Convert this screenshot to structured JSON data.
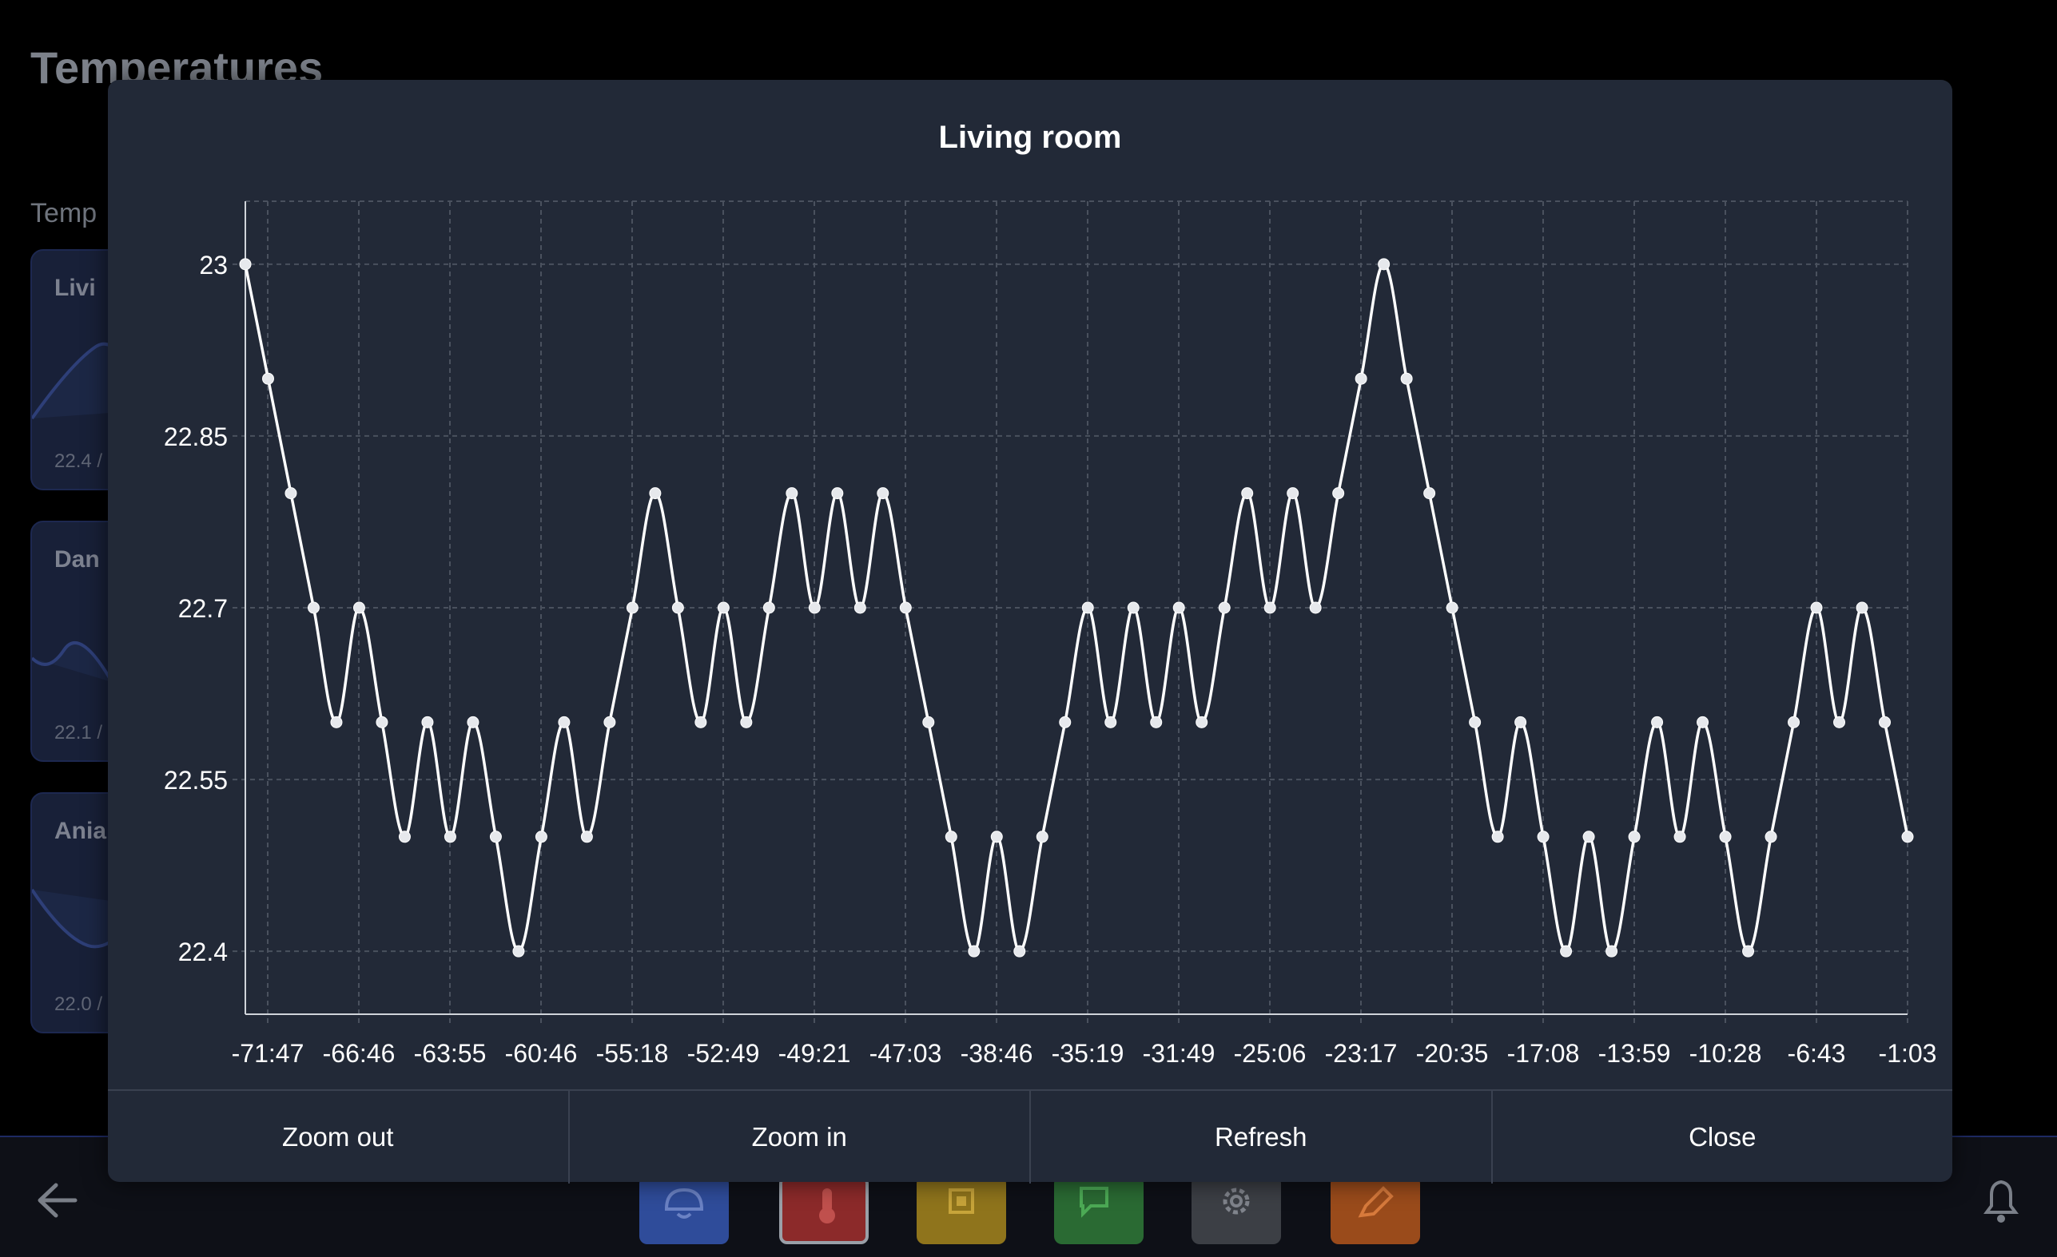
{
  "page": {
    "title": "Temperatures",
    "section_label": "Temp"
  },
  "cards": [
    {
      "title": "Livi",
      "value": "22.4 /"
    },
    {
      "title": "Dan",
      "value": "22.1 /"
    },
    {
      "title": "Ania",
      "value": "22.0 /"
    }
  ],
  "nav": [
    {
      "icon": "alarm-icon",
      "color": "#2f4c9a"
    },
    {
      "icon": "thermometer-icon",
      "color": "#8c2a2a"
    },
    {
      "icon": "chip-icon",
      "color": "#8f741c"
    },
    {
      "icon": "chat-icon",
      "color": "#2a6a33"
    },
    {
      "icon": "gear-icon",
      "color": "#3c3f45"
    },
    {
      "icon": "pen-icon",
      "color": "#9a4b1b"
    }
  ],
  "modal": {
    "title": "Living room",
    "buttons": {
      "zoom_out": "Zoom out",
      "zoom_in": "Zoom in",
      "refresh": "Refresh",
      "close": "Close"
    }
  },
  "chart_data": {
    "type": "line",
    "title": "Living room",
    "xlabel": "",
    "ylabel": "",
    "ylim": [
      22.345,
      23.055
    ],
    "y_ticks": [
      22.4,
      22.55,
      22.7,
      22.85,
      23
    ],
    "x_tick_labels": [
      "-71:47",
      "-66:46",
      "-63:55",
      "-60:46",
      "-55:18",
      "-52:49",
      "-49:21",
      "-47:03",
      "-38:46",
      "-35:19",
      "-31:49",
      "-25:06",
      "-23:17",
      "-20:35",
      "-17:08",
      "-13:59",
      "-10:28",
      "-6:43",
      "-1:03"
    ],
    "grid": true,
    "legend": "none",
    "line_color": "#ffffff",
    "values": [
      23.0,
      22.9,
      22.8,
      22.7,
      22.6,
      22.7,
      22.6,
      22.5,
      22.6,
      22.5,
      22.6,
      22.5,
      22.4,
      22.5,
      22.6,
      22.5,
      22.6,
      22.7,
      22.8,
      22.7,
      22.6,
      22.7,
      22.6,
      22.7,
      22.8,
      22.7,
      22.8,
      22.7,
      22.8,
      22.7,
      22.6,
      22.5,
      22.4,
      22.5,
      22.4,
      22.5,
      22.6,
      22.7,
      22.6,
      22.7,
      22.6,
      22.7,
      22.6,
      22.7,
      22.8,
      22.7,
      22.8,
      22.7,
      22.8,
      22.9,
      23.0,
      22.9,
      22.8,
      22.7,
      22.6,
      22.5,
      22.6,
      22.5,
      22.4,
      22.5,
      22.4,
      22.5,
      22.6,
      22.5,
      22.6,
      22.5,
      22.4,
      22.5,
      22.6,
      22.7,
      22.6,
      22.7,
      22.6,
      22.5
    ]
  }
}
